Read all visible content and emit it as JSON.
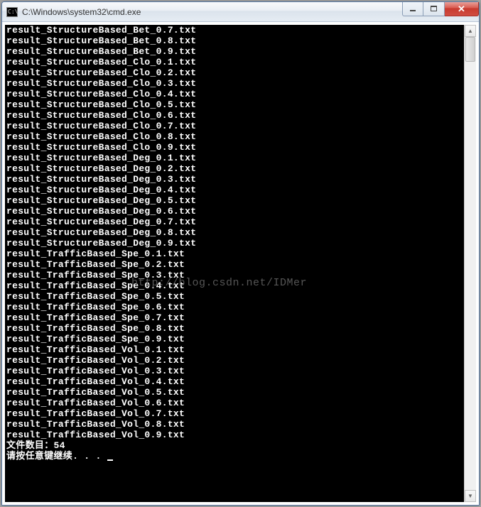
{
  "window": {
    "title": "C:\\Windows\\system32\\cmd.exe",
    "icon_label": "cmd-icon"
  },
  "watermark": "http://blog.csdn.net/IDMer",
  "console": {
    "lines": [
      "result_StructureBased_Bet_0.7.txt",
      "result_StructureBased_Bet_0.8.txt",
      "result_StructureBased_Bet_0.9.txt",
      "result_StructureBased_Clo_0.1.txt",
      "result_StructureBased_Clo_0.2.txt",
      "result_StructureBased_Clo_0.3.txt",
      "result_StructureBased_Clo_0.4.txt",
      "result_StructureBased_Clo_0.5.txt",
      "result_StructureBased_Clo_0.6.txt",
      "result_StructureBased_Clo_0.7.txt",
      "result_StructureBased_Clo_0.8.txt",
      "result_StructureBased_Clo_0.9.txt",
      "result_StructureBased_Deg_0.1.txt",
      "result_StructureBased_Deg_0.2.txt",
      "result_StructureBased_Deg_0.3.txt",
      "result_StructureBased_Deg_0.4.txt",
      "result_StructureBased_Deg_0.5.txt",
      "result_StructureBased_Deg_0.6.txt",
      "result_StructureBased_Deg_0.7.txt",
      "result_StructureBased_Deg_0.8.txt",
      "result_StructureBased_Deg_0.9.txt",
      "result_TrafficBased_Spe_0.1.txt",
      "result_TrafficBased_Spe_0.2.txt",
      "result_TrafficBased_Spe_0.3.txt",
      "result_TrafficBased_Spe_0.4.txt",
      "result_TrafficBased_Spe_0.5.txt",
      "result_TrafficBased_Spe_0.6.txt",
      "result_TrafficBased_Spe_0.7.txt",
      "result_TrafficBased_Spe_0.8.txt",
      "result_TrafficBased_Spe_0.9.txt",
      "result_TrafficBased_Vol_0.1.txt",
      "result_TrafficBased_Vol_0.2.txt",
      "result_TrafficBased_Vol_0.3.txt",
      "result_TrafficBased_Vol_0.4.txt",
      "result_TrafficBased_Vol_0.5.txt",
      "result_TrafficBased_Vol_0.6.txt",
      "result_TrafficBased_Vol_0.7.txt",
      "result_TrafficBased_Vol_0.8.txt",
      "result_TrafficBased_Vol_0.9.txt",
      "文件数目：54",
      "请按任意键继续. . . "
    ]
  }
}
